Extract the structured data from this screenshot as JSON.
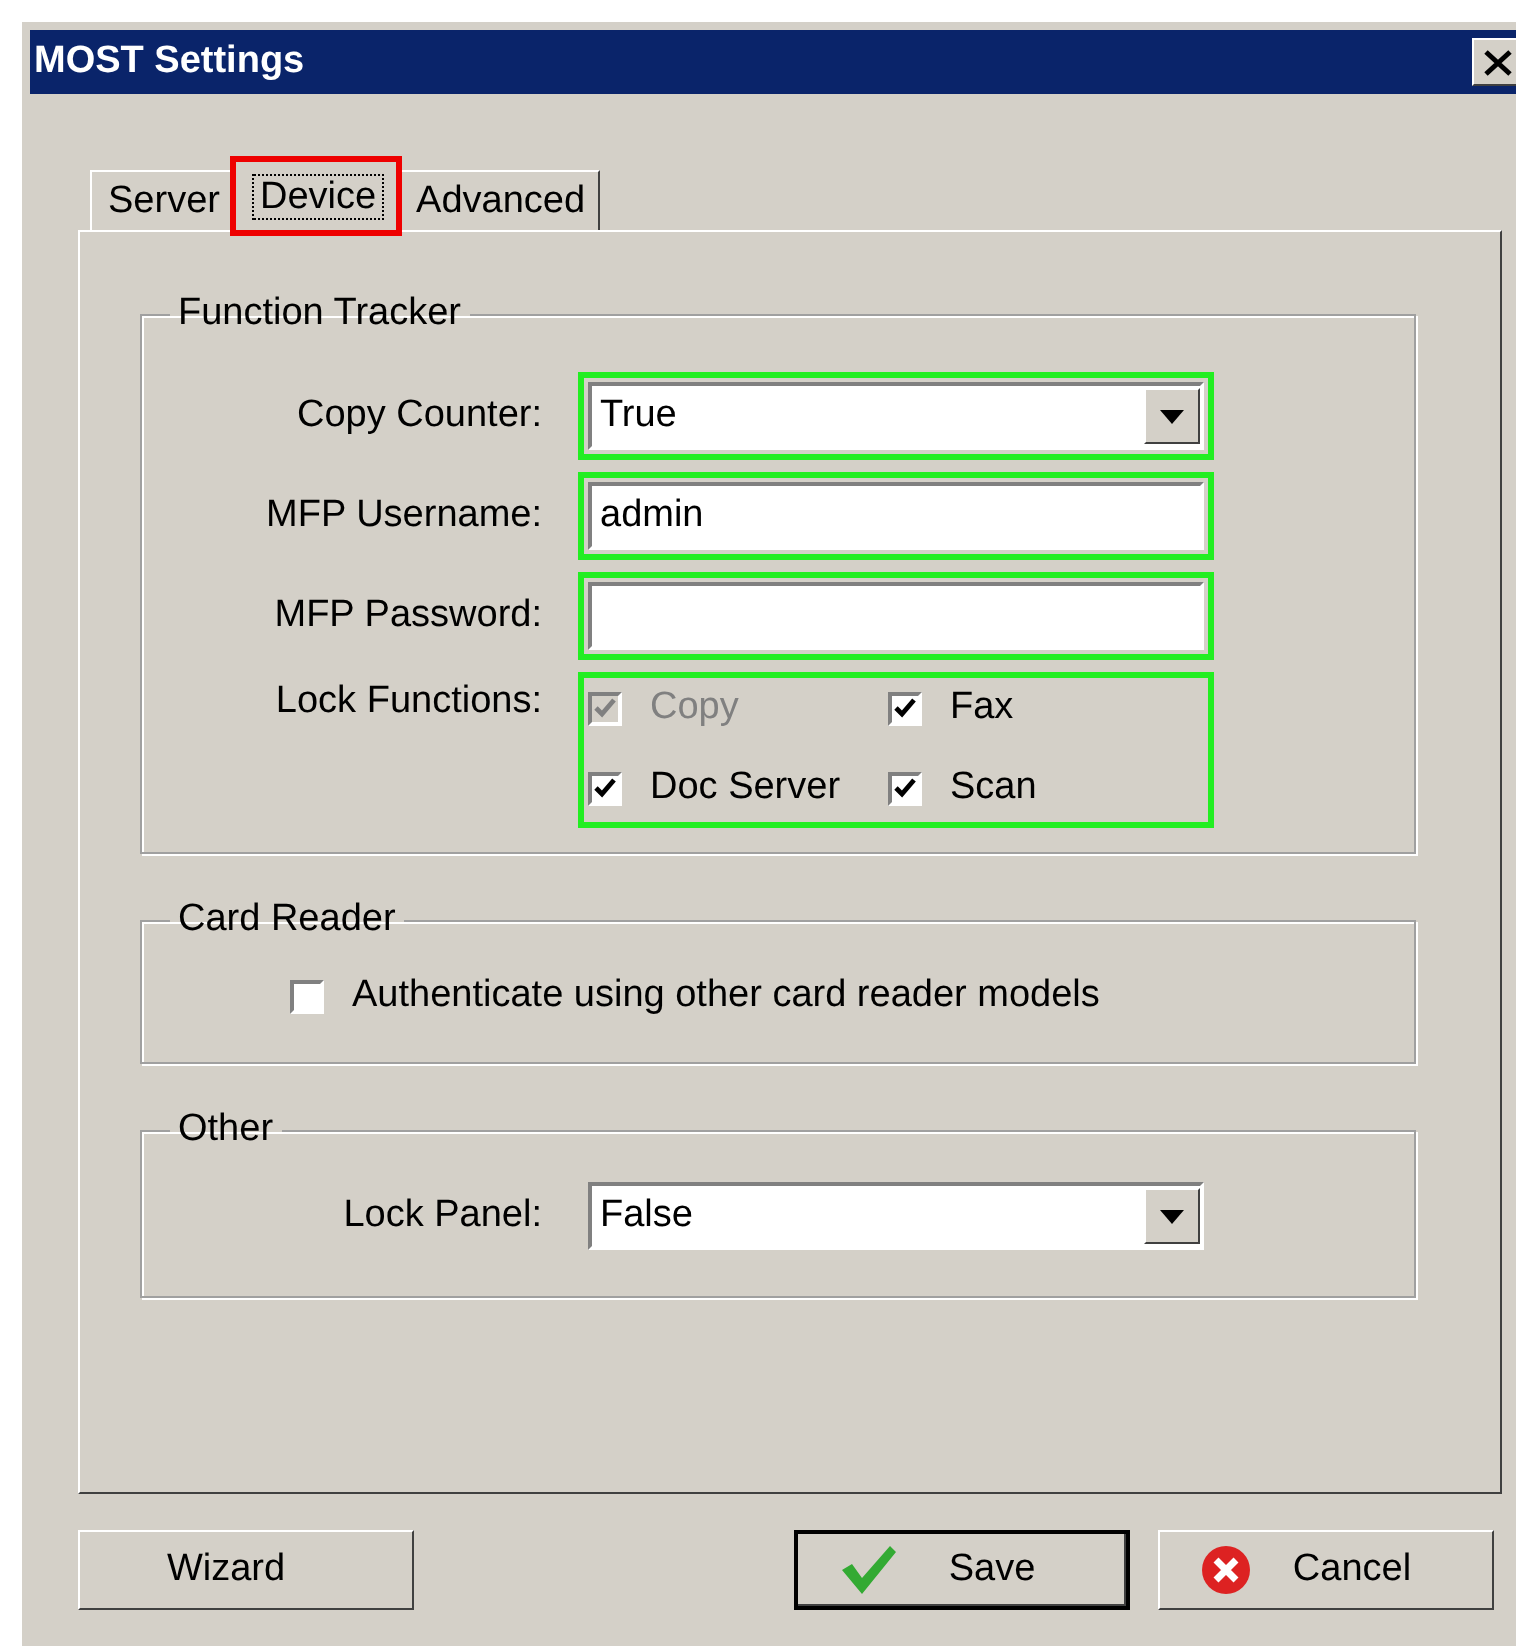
{
  "window": {
    "title": "MOST Settings"
  },
  "tabs": [
    {
      "label": "Server",
      "selected": false,
      "highlighted": false
    },
    {
      "label": "Device",
      "selected": true,
      "highlighted": true
    },
    {
      "label": "Advanced",
      "selected": false,
      "highlighted": false
    }
  ],
  "function_tracker": {
    "title": "Function Tracker",
    "fields": [
      {
        "kind": "dropdown",
        "label": "Copy Counter:",
        "value": "True",
        "highlighted": true
      },
      {
        "kind": "text",
        "label": "MFP Username:",
        "value": "admin",
        "highlighted": true
      },
      {
        "kind": "password",
        "label": "MFP Password:",
        "highlighted": true
      }
    ],
    "lock_functions": {
      "label": "Lock Functions:",
      "highlighted": true,
      "options": [
        {
          "label": "Copy",
          "checked": true,
          "disabled": true
        },
        {
          "label": "Fax",
          "checked": true,
          "disabled": false
        },
        {
          "label": "Doc Server",
          "checked": true,
          "disabled": false
        },
        {
          "label": "Scan",
          "checked": true,
          "disabled": false
        }
      ]
    }
  },
  "card_reader": {
    "title": "Card Reader",
    "options": [
      {
        "label": "Authenticate using other card reader models",
        "checked": false,
        "disabled": false
      }
    ]
  },
  "other": {
    "title": "Other",
    "fields": [
      {
        "kind": "dropdown",
        "label": "Lock Panel:",
        "value": "False"
      }
    ]
  },
  "buttons": [
    {
      "label": "Wizard",
      "kind": "plain",
      "default": false
    },
    {
      "label": "Save",
      "kind": "confirm",
      "default": true
    },
    {
      "label": "Cancel",
      "kind": "cancel",
      "default": false
    }
  ]
}
